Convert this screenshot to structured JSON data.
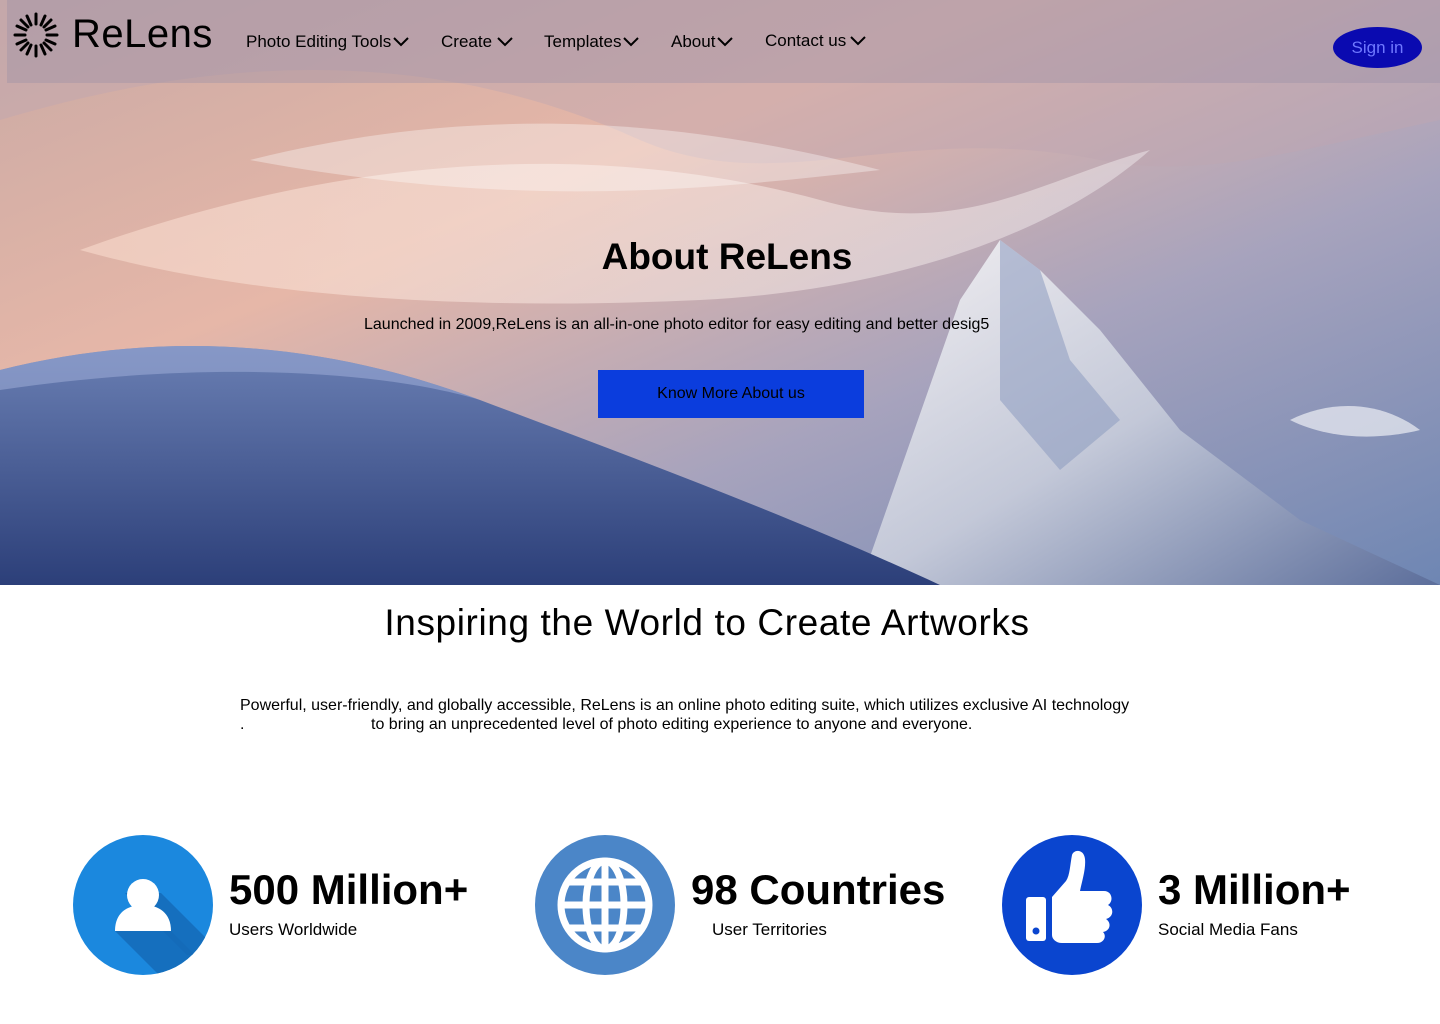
{
  "brand": {
    "name": "ReLens",
    "logo_icon": "sunburst-logo-icon"
  },
  "nav": {
    "items": [
      {
        "label": "Photo Editing Tools",
        "icon": "chevron-down-icon"
      },
      {
        "label": "Create",
        "icon": "chevron-down-icon"
      },
      {
        "label": "Templates",
        "icon": "chevron-down-icon"
      },
      {
        "label": "About",
        "icon": "chevron-down-icon"
      },
      {
        "label": "Contact us",
        "icon": "chevron-down-icon"
      }
    ],
    "signin_label": "Sign in"
  },
  "hero": {
    "title": "About ReLens",
    "subtitle": "Launched in 2009,ReLens is an all-in-one photo editor for easy editing and better desig5",
    "button_label": "Know More About us",
    "background": "snowy-mountain-sunset-photo"
  },
  "section": {
    "title": "Inspiring the World to Create Artworks",
    "line1": "Powerful, user-friendly, and globally accessible, ReLens is an online photo editing suite, which utilizes exclusive AI technology",
    "line2_prefix": ".",
    "line2": "to bring an unprecedented level of photo editing experience to anyone and everyone."
  },
  "stats": [
    {
      "value": "500 Million+",
      "label": "Users Worldwide",
      "icon": "user-icon"
    },
    {
      "value": "98 Countries",
      "label": "User Territories",
      "icon": "globe-icon"
    },
    {
      "value": "3 Million+",
      "label": "Social Media Fans",
      "icon": "thumbs-up-icon"
    }
  ],
  "colors": {
    "accent_button": "#0b3ddd",
    "signin_bg": "#0a0ab0",
    "user_icon": "#1b88de",
    "globe_icon": "#4b86c8",
    "thumbs_icon": "#0a45cf"
  }
}
